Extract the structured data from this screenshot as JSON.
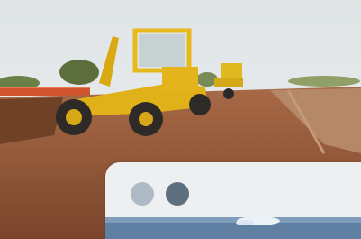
{
  "scene": {
    "image_name": "road-construction-photo",
    "subject": "motor-grader-on-dirt-road"
  },
  "card": {
    "background": "#eeeff1",
    "dots": [
      {
        "name": "dot-light",
        "color": "#aebbc7"
      },
      {
        "name": "dot-dark",
        "color": "#5e6f80"
      }
    ],
    "preview_name": "sky-preview-image"
  }
}
